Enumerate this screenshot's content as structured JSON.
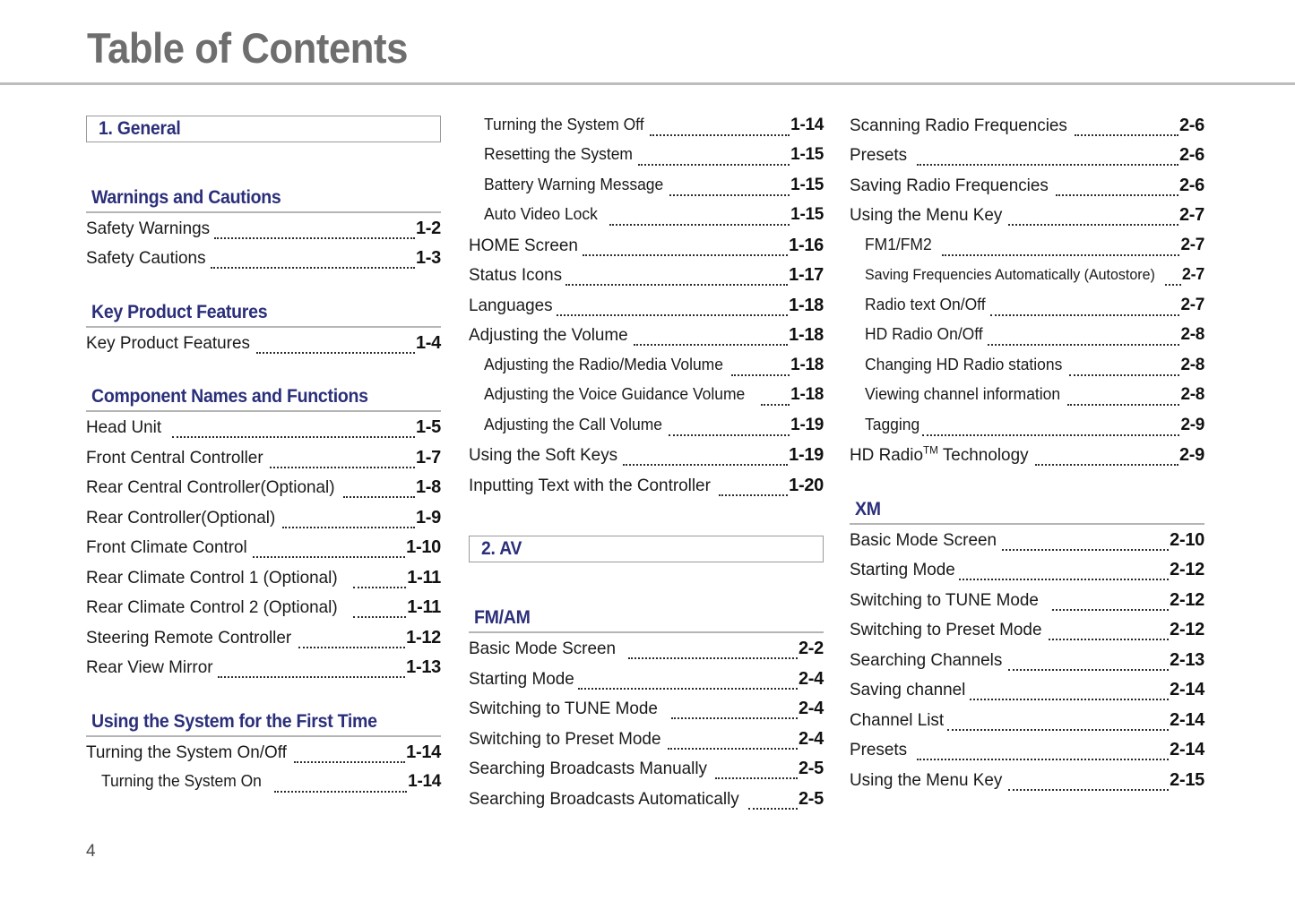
{
  "document": {
    "title": "Table of Contents",
    "page_number": "4"
  },
  "colors": {
    "accent_navy": "#2b2f7a",
    "title_gray": "#6e6e6e",
    "rule_gray": "#bdbdbd"
  },
  "columns": [
    {
      "id": "column-1",
      "blocks": [
        {
          "type": "chapter",
          "label": "1. General"
        },
        {
          "type": "section",
          "label": "Warnings and Cautions"
        },
        {
          "type": "entries",
          "items": [
            {
              "label": "Safety Warnings",
              "page": "1-2",
              "level": 0
            },
            {
              "label": "Safety Cautions",
              "page": "1-3",
              "level": 0
            }
          ]
        },
        {
          "type": "section",
          "label": "Key Product Features"
        },
        {
          "type": "entries",
          "items": [
            {
              "label": "Key Product Features",
              "page": "1-4",
              "level": 0
            }
          ]
        },
        {
          "type": "section",
          "label": "Component Names and Functions"
        },
        {
          "type": "entries",
          "items": [
            {
              "label": "Head Unit",
              "page": "1-5",
              "level": 0,
              "gap": true
            },
            {
              "label": "Front Central Controller",
              "page": "1-7",
              "level": 0
            },
            {
              "label": "Rear Central Controller(Optional)",
              "page": "1-8",
              "level": 0
            },
            {
              "label": "Rear Controller(Optional)",
              "page": "1-9",
              "level": 0
            },
            {
              "label": "Front Climate Control",
              "page": "1-10",
              "level": 0
            },
            {
              "label": "Rear Climate Control 1 (Optional)",
              "page": "1-11",
              "level": 0,
              "gap": true
            },
            {
              "label": "Rear Climate Control 2 (Optional)",
              "page": "1-11",
              "level": 0,
              "gap": true
            },
            {
              "label": "Steering Remote Controller",
              "page": "1-12",
              "level": 0
            },
            {
              "label": "Rear View Mirror",
              "page": "1-13",
              "level": 0
            }
          ]
        },
        {
          "type": "section",
          "label": "Using the System for the First Time"
        },
        {
          "type": "entries",
          "items": [
            {
              "label": "Turning the System On/Off",
              "page": "1-14",
              "level": 0
            },
            {
              "label": "Turning the System On",
              "page": "1-14",
              "level": 1,
              "gap": true
            }
          ]
        }
      ]
    },
    {
      "id": "column-2",
      "blocks": [
        {
          "type": "entries",
          "items": [
            {
              "label": "Turning the System Off",
              "page": "1-14",
              "level": 1
            },
            {
              "label": "Resetting the System",
              "page": "1-15",
              "level": 1
            },
            {
              "label": "Battery Warning Message",
              "page": "1-15",
              "level": 1
            },
            {
              "label": "Auto Video Lock",
              "page": "1-15",
              "level": 1,
              "gap": true
            },
            {
              "label": "HOME Screen",
              "page": "1-16",
              "level": 0
            },
            {
              "label": "Status Icons",
              "page": "1-17",
              "level": 0
            },
            {
              "label": "Languages",
              "page": "1-18",
              "level": 0
            },
            {
              "label": "Adjusting the Volume",
              "page": "1-18",
              "level": 0
            },
            {
              "label": "Adjusting the Radio/Media Volume",
              "page": "1-18",
              "level": 1
            },
            {
              "label": "Adjusting the Voice Guidance Volume",
              "page": "1-18",
              "level": 1,
              "gap": true
            },
            {
              "label": "Adjusting the Call Volume",
              "page": "1-19",
              "level": 1
            },
            {
              "label": "Using the Soft Keys",
              "page": "1-19",
              "level": 0
            },
            {
              "label": "Inputting Text with the Controller",
              "page": "1-20",
              "level": 0
            }
          ]
        },
        {
          "type": "chapter",
          "label": "2. AV"
        },
        {
          "type": "section",
          "label": "FM/AM"
        },
        {
          "type": "entries",
          "items": [
            {
              "label": "Basic Mode Screen",
              "page": "2-2",
              "level": 0,
              "gap": true
            },
            {
              "label": "Starting Mode",
              "page": "2-4",
              "level": 0
            },
            {
              "label": "Switching to TUNE Mode",
              "page": "2-4",
              "level": 0,
              "gap": true
            },
            {
              "label": "Switching to Preset Mode",
              "page": "2-4",
              "level": 0
            },
            {
              "label": "Searching Broadcasts Manually",
              "page": "2-5",
              "level": 0
            },
            {
              "label": "Searching Broadcasts Automatically",
              "page": "2-5",
              "level": 0
            }
          ]
        }
      ]
    },
    {
      "id": "column-3",
      "blocks": [
        {
          "type": "entries",
          "items": [
            {
              "label": "Scanning Radio Frequencies",
              "page": "2-6",
              "level": 0
            },
            {
              "label": "Presets",
              "page": "2-6",
              "level": 0,
              "gap": true
            },
            {
              "label": "Saving Radio Frequencies",
              "page": "2-6",
              "level": 0
            },
            {
              "label": "Using the Menu Key",
              "page": "2-7",
              "level": 0
            },
            {
              "label": "FM1/FM2",
              "page": "2-7",
              "level": 1,
              "gap": true
            },
            {
              "label": "Saving Frequencies Automatically (Autostore)",
              "page": "2-7",
              "level": 1,
              "tight": true
            },
            {
              "label": "Radio text On/Off",
              "page": "2-7",
              "level": 1
            },
            {
              "label": "HD Radio On/Off",
              "page": "2-8",
              "level": 1
            },
            {
              "label": "Changing HD Radio stations",
              "page": "2-8",
              "level": 1
            },
            {
              "label": "Viewing channel information",
              "page": "2-8",
              "level": 1
            },
            {
              "label": "Tagging",
              "page": "2-9",
              "level": 1
            },
            {
              "label": "HD Radio|TM| Technology",
              "page": "2-9",
              "level": 0,
              "trademark": true
            }
          ]
        },
        {
          "type": "section",
          "label": "XM"
        },
        {
          "type": "entries",
          "items": [
            {
              "label": "Basic Mode Screen",
              "page": "2-10",
              "level": 0
            },
            {
              "label": "Starting Mode",
              "page": "2-12",
              "level": 0
            },
            {
              "label": "Switching to TUNE Mode",
              "page": "2-12",
              "level": 0,
              "gap": true
            },
            {
              "label": "Switching to Preset Mode",
              "page": "2-12",
              "level": 0
            },
            {
              "label": "Searching Channels",
              "page": "2-13",
              "level": 0
            },
            {
              "label": "Saving channel",
              "page": "2-14",
              "level": 0
            },
            {
              "label": "Channel List",
              "page": "2-14",
              "level": 0
            },
            {
              "label": "Presets",
              "page": "2-14",
              "level": 0,
              "gap": true
            },
            {
              "label": "Using the Menu Key",
              "page": "2-15",
              "level": 0
            }
          ]
        }
      ]
    }
  ]
}
